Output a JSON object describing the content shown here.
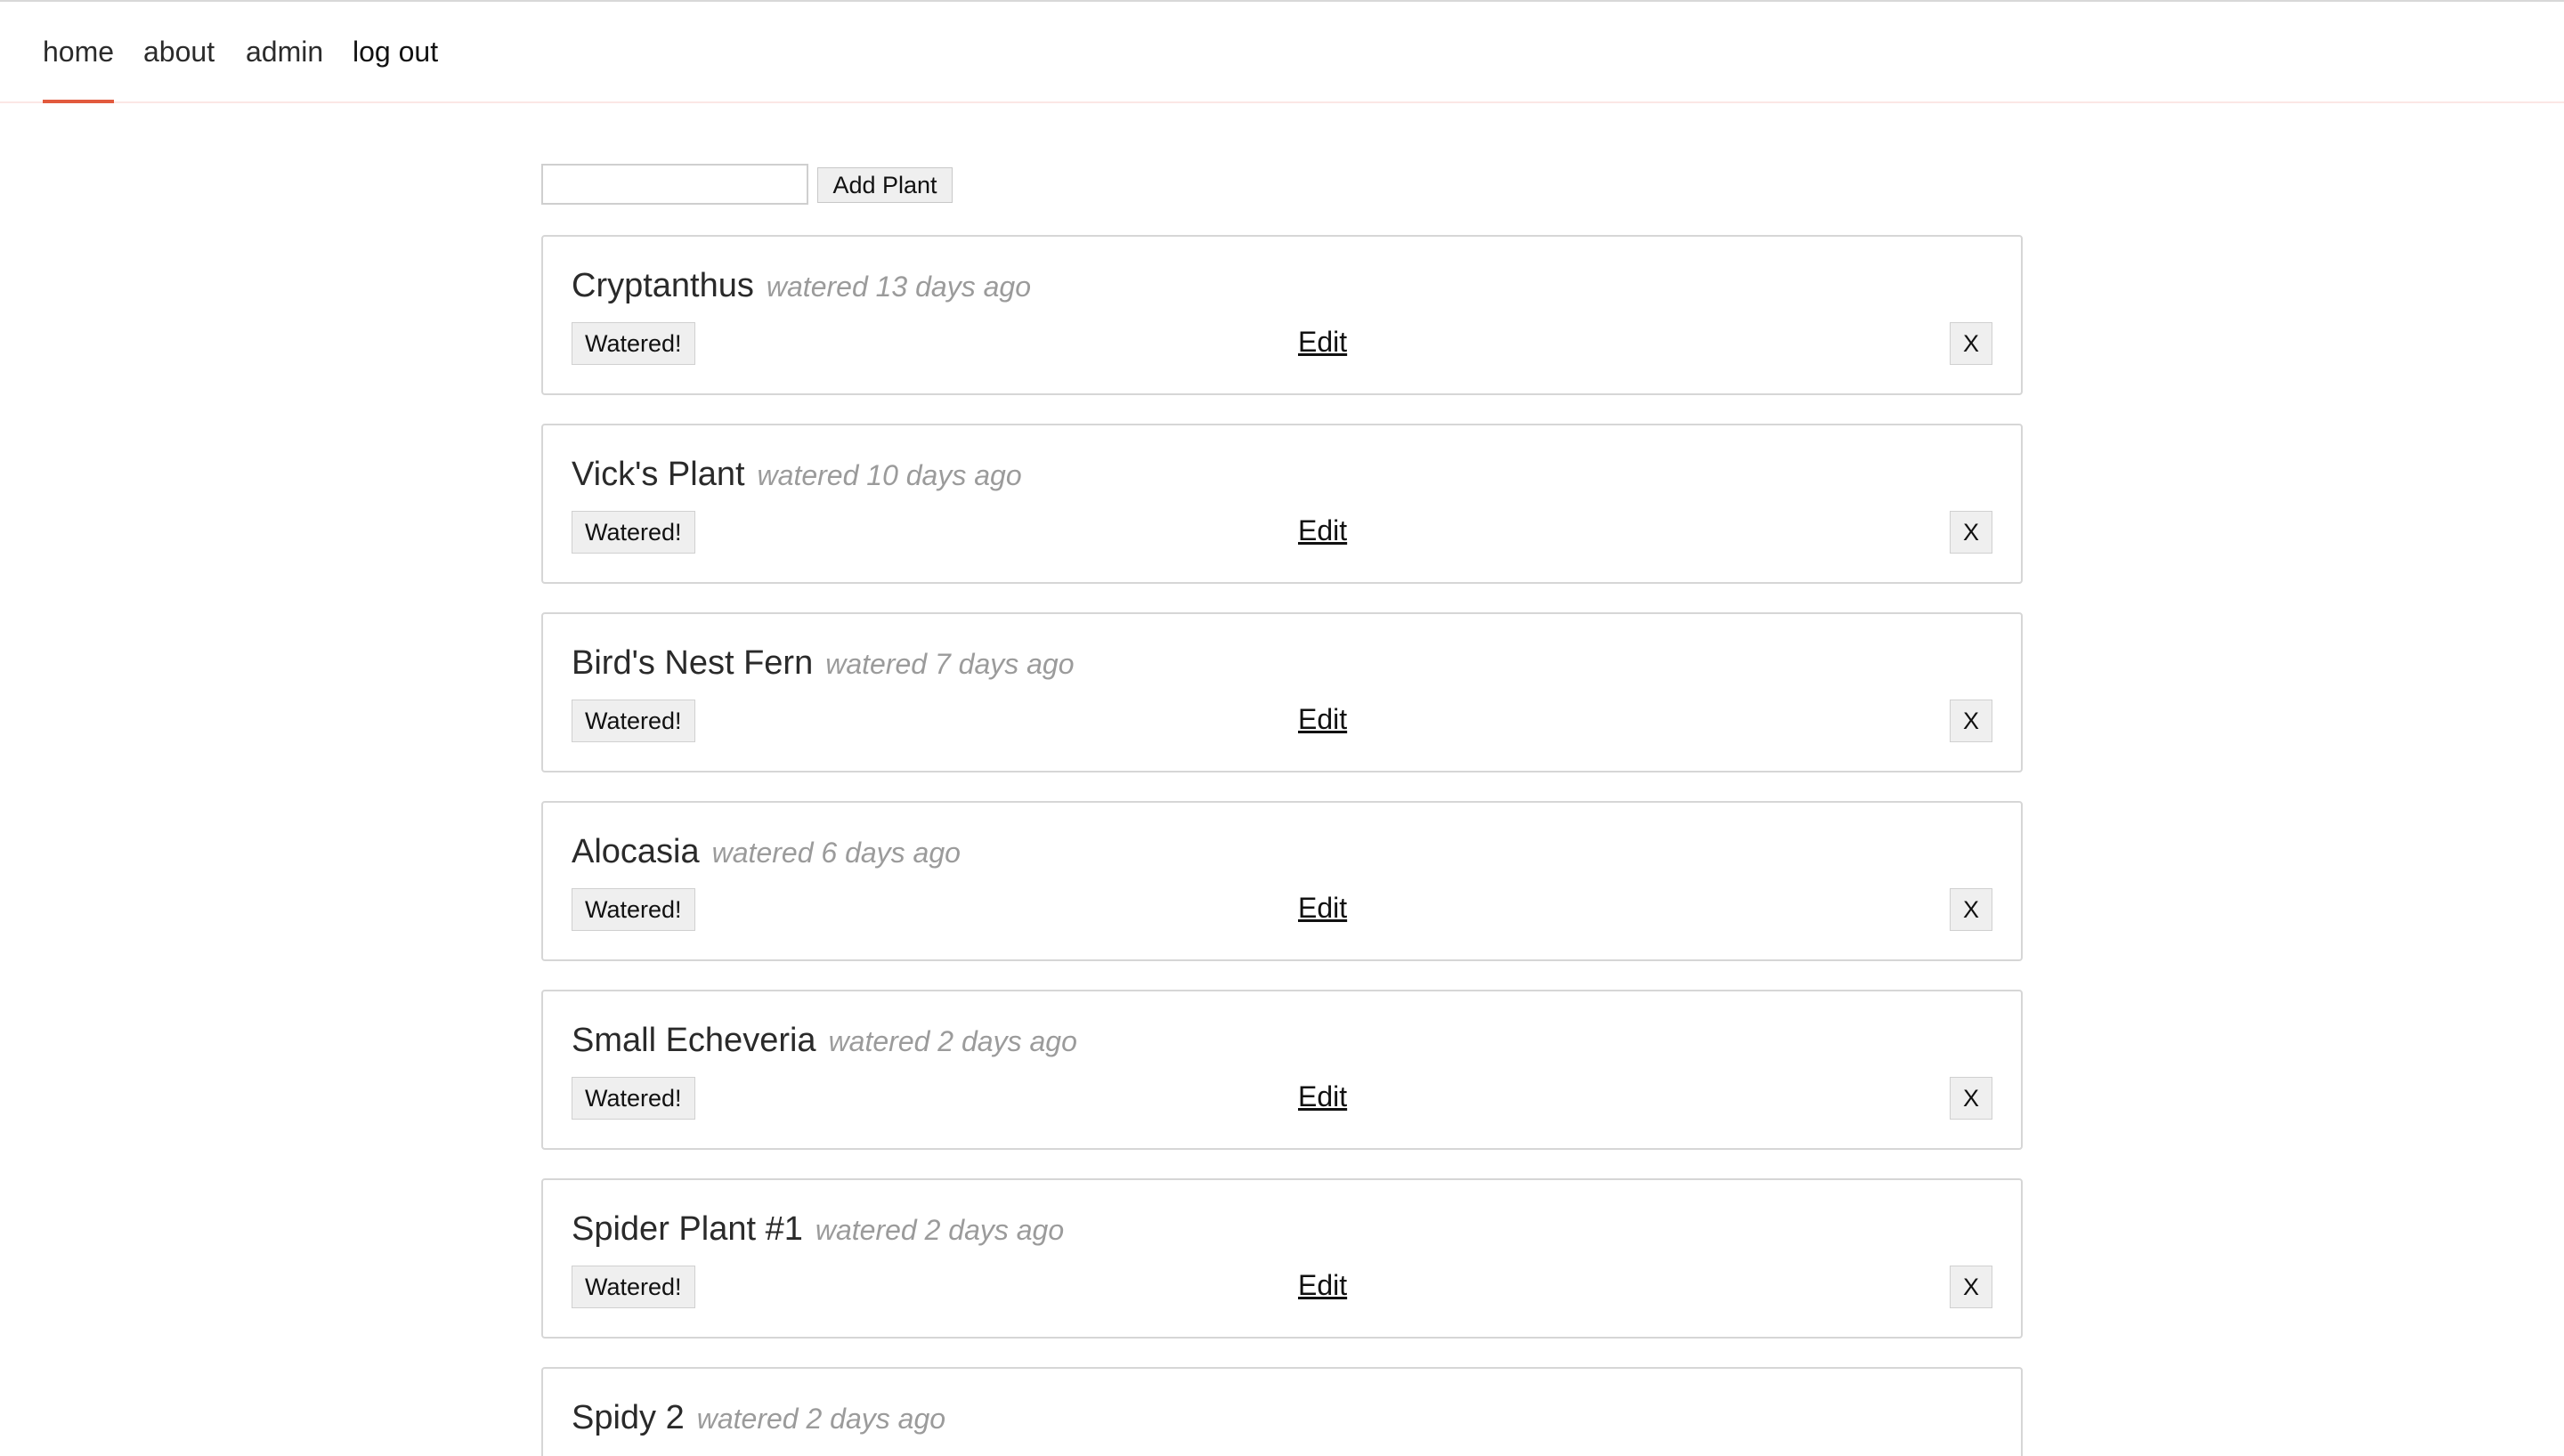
{
  "nav": {
    "items": [
      {
        "label": "home",
        "active": true
      },
      {
        "label": "about",
        "active": false
      },
      {
        "label": "admin",
        "active": false
      },
      {
        "label": "log out",
        "active": false
      }
    ]
  },
  "add_form": {
    "input_value": "",
    "button_label": "Add Plant"
  },
  "plants": [
    {
      "name": "Cryptanthus",
      "watered": "watered 13 days ago",
      "watered_button": "Watered!",
      "edit_label": "Edit",
      "delete_label": "X"
    },
    {
      "name": "Vick's Plant",
      "watered": "watered 10 days ago",
      "watered_button": "Watered!",
      "edit_label": "Edit",
      "delete_label": "X"
    },
    {
      "name": "Bird's Nest Fern",
      "watered": "watered 7 days ago",
      "watered_button": "Watered!",
      "edit_label": "Edit",
      "delete_label": "X"
    },
    {
      "name": "Alocasia",
      "watered": "watered 6 days ago",
      "watered_button": "Watered!",
      "edit_label": "Edit",
      "delete_label": "X"
    },
    {
      "name": "Small Echeveria",
      "watered": "watered 2 days ago",
      "watered_button": "Watered!",
      "edit_label": "Edit",
      "delete_label": "X"
    },
    {
      "name": "Spider Plant #1",
      "watered": "watered 2 days ago",
      "watered_button": "Watered!",
      "edit_label": "Edit",
      "delete_label": "X"
    },
    {
      "name": "Spidy 2",
      "watered": "watered 2 days ago"
    }
  ],
  "colors": {
    "accent": "#e25a3d",
    "muted_text": "#9b9b9b",
    "card_border": "#d6d6d6"
  }
}
